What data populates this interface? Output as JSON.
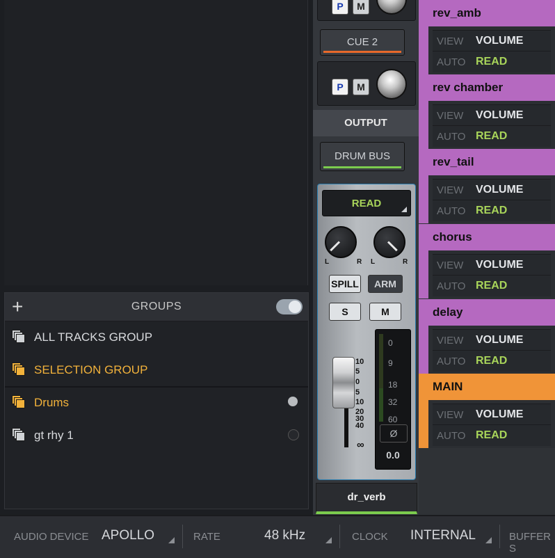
{
  "groups": {
    "title": "GROUPS",
    "add_icon": "+",
    "items": [
      {
        "label": "ALL TRACKS GROUP",
        "icon": "group-stack-icon",
        "color": "#d0d3d6"
      },
      {
        "label": "SELECTION GROUP",
        "icon": "group-stack-icon",
        "color": "#f2b23b"
      },
      {
        "label": "Drums",
        "icon": "group-stack-icon",
        "color": "#f2b23b",
        "dot": "filled"
      },
      {
        "label": "gt rhy 1",
        "icon": "group-stack-icon",
        "color": "#d0d3d6",
        "dot": "empty"
      }
    ]
  },
  "strip": {
    "p_label": "P",
    "m_label": "M",
    "cue_label": "CUE 2",
    "output_label": "OUTPUT",
    "output_value": "DRUM BUS",
    "automation": "READ",
    "pan_l": "L",
    "pan_r": "R",
    "spill": "SPILL",
    "arm": "ARM",
    "solo": "S",
    "mute": "M",
    "fader_scale": [
      "10",
      "5",
      "0",
      "5",
      "10",
      "20",
      "30",
      "40",
      "∞"
    ],
    "meter_scale": [
      "0",
      "9",
      "18",
      "32",
      "60"
    ],
    "phase": "Ø",
    "fader_value": "0.0",
    "track_name": "dr_verb"
  },
  "sends": [
    {
      "name": "rev_amb",
      "color": "#b569c0"
    },
    {
      "name": "rev chamber",
      "color": "#b569c0"
    },
    {
      "name": "rev_tail",
      "color": "#b569c0"
    },
    {
      "name": "chorus",
      "color": "#b569c0"
    },
    {
      "name": "delay",
      "color": "#b569c0"
    },
    {
      "name": "MAIN",
      "color": "#f09438"
    }
  ],
  "send_row": {
    "view_key": "VIEW",
    "view_value": "VOLUME",
    "auto_key": "AUTO",
    "auto_value": "READ"
  },
  "bottom": {
    "audio_device_label": "AUDIO DEVICE",
    "audio_device_value": "APOLLO",
    "rate_label": "RATE",
    "rate_value": "48 kHz",
    "clock_label": "CLOCK",
    "clock_value": "INTERNAL",
    "buffer_label": "BUFFER S"
  }
}
